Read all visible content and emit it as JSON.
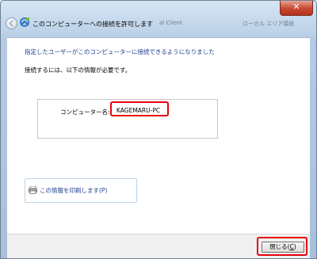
{
  "window": {
    "title": "このコンピューターへの接続を許可します",
    "bg_fragments": [
      "al Client",
      "ローカル エリア接続"
    ]
  },
  "main": {
    "heading": "指定したユーザーがこのコンピューターに接続できるようになりました",
    "instruction": "接続するには、以下の情報が必要です。",
    "computer_name_label": "コンピューター名:",
    "computer_name_value": "KAGEMARU-PC",
    "print_link": "この情報を印刷します(P)"
  },
  "footer": {
    "close_label_text": "閉じる(",
    "close_label_key": "C",
    "close_label_end": ")"
  }
}
